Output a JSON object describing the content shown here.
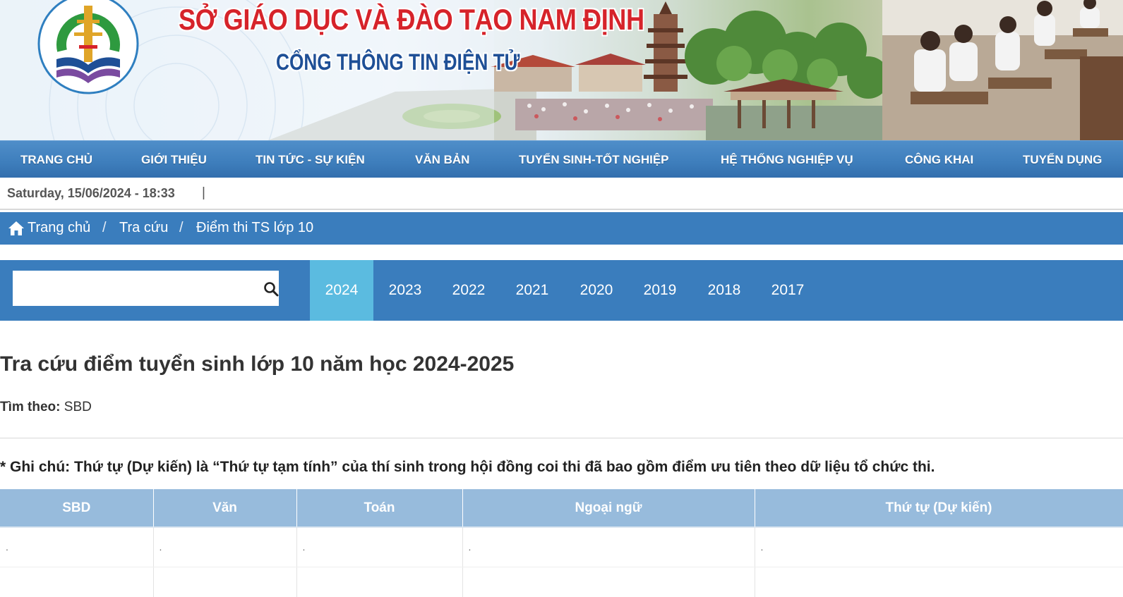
{
  "banner": {
    "title": "SỞ GIÁO DỤC VÀ ĐÀO TẠO NAM ĐỊNH",
    "subtitle": "CỔNG THÔNG TIN ĐIỆN TỬ"
  },
  "nav": {
    "items": [
      {
        "label": "TRANG CHỦ"
      },
      {
        "label": "GIỚI THIỆU"
      },
      {
        "label": "TIN TỨC - SỰ KIỆN"
      },
      {
        "label": "VĂN BẢN"
      },
      {
        "label": "TUYỂN SINH-TỐT NGHIỆP"
      },
      {
        "label": "HỆ THỐNG NGHIỆP VỤ"
      },
      {
        "label": "CÔNG KHAI"
      },
      {
        "label": "TUYỂN DỤNG"
      }
    ]
  },
  "datebar": {
    "datetime": "Saturday, 15/06/2024 - 18:33",
    "separator": "|"
  },
  "breadcrumb": {
    "items": [
      {
        "label": "Trang chủ"
      },
      {
        "label": "Tra cứu"
      },
      {
        "label": "Điểm thi TS lớp 10"
      }
    ],
    "separator": "/"
  },
  "search": {
    "value": "",
    "placeholder": ""
  },
  "years": {
    "active": "2024",
    "items": [
      {
        "label": "2024"
      },
      {
        "label": "2023"
      },
      {
        "label": "2022"
      },
      {
        "label": "2021"
      },
      {
        "label": "2020"
      },
      {
        "label": "2019"
      },
      {
        "label": "2018"
      },
      {
        "label": "2017"
      }
    ]
  },
  "content": {
    "title": "Tra cứu điểm tuyển sinh lớp 10 năm học 2024-2025",
    "filter_label": "Tìm theo:",
    "filter_value": "SBD",
    "note": "* Ghi chú: Thứ tự (Dự kiến) là “Thứ tự tạm tính” của thí sinh trong hội đồng coi thi đã bao gồm điểm ưu tiên theo dữ liệu tổ chức thi."
  },
  "table": {
    "columns": [
      {
        "label": "SBD"
      },
      {
        "label": "Văn"
      },
      {
        "label": "Toán"
      },
      {
        "label": "Ngoại ngữ"
      },
      {
        "label": "Thứ tự (Dự kiến)"
      }
    ],
    "rows": [
      [
        ".",
        ".",
        ".",
        ".",
        "."
      ],
      [
        "",
        "",
        "",
        "",
        ""
      ]
    ]
  },
  "colors": {
    "nav": "#3f7fbd",
    "breadcrumb": "#3a7dbd",
    "year_active": "#5bbbe0",
    "table_header": "#97bbdc",
    "banner_title": "#d6232a",
    "banner_subtitle": "#1e4f96"
  }
}
